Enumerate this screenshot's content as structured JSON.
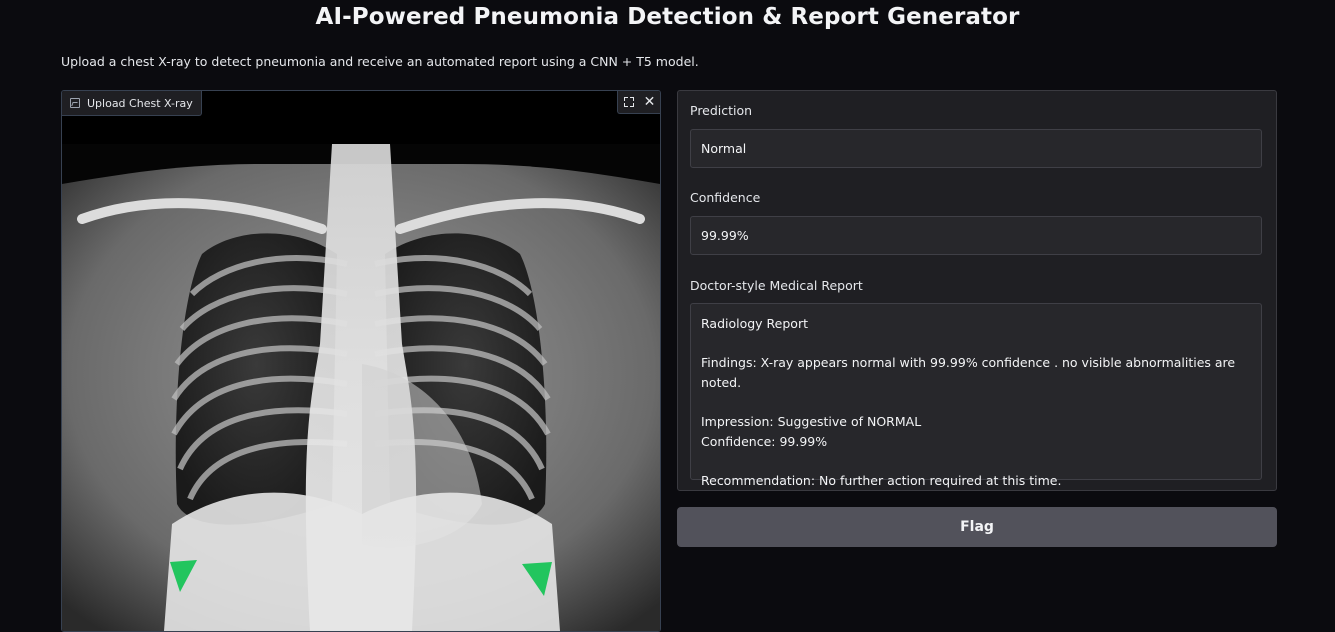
{
  "header": {
    "title": "AI-Powered Pneumonia Detection & Report Generator",
    "description": "Upload a chest X-ray to detect pneumonia and receive an automated report using a CNN + T5 model."
  },
  "image_input": {
    "label": "Upload Chest X-ray",
    "image_icon": "image-icon",
    "fullscreen_icon": "fullscreen-icon",
    "close_icon": "close-icon",
    "close_glyph": "✕"
  },
  "outputs": {
    "prediction_label": "Prediction",
    "prediction_value": "Normal",
    "confidence_label": "Confidence",
    "confidence_value": "99.99%",
    "report_label": "Doctor-style Medical Report",
    "report_text": "Radiology Report\n\nFindings: X-ray appears normal with 99.99% confidence . no visible abnormalities are noted.\n\nImpression: Suggestive of NORMAL\nConfidence: 99.99%\n\nRecommendation: No further action required at this time."
  },
  "actions": {
    "flag_label": "Flag"
  },
  "colors": {
    "background": "#0b0b0f",
    "panel": "#1f1f23",
    "field": "#27272b",
    "button": "#52525b",
    "marker": "#22c55e"
  }
}
